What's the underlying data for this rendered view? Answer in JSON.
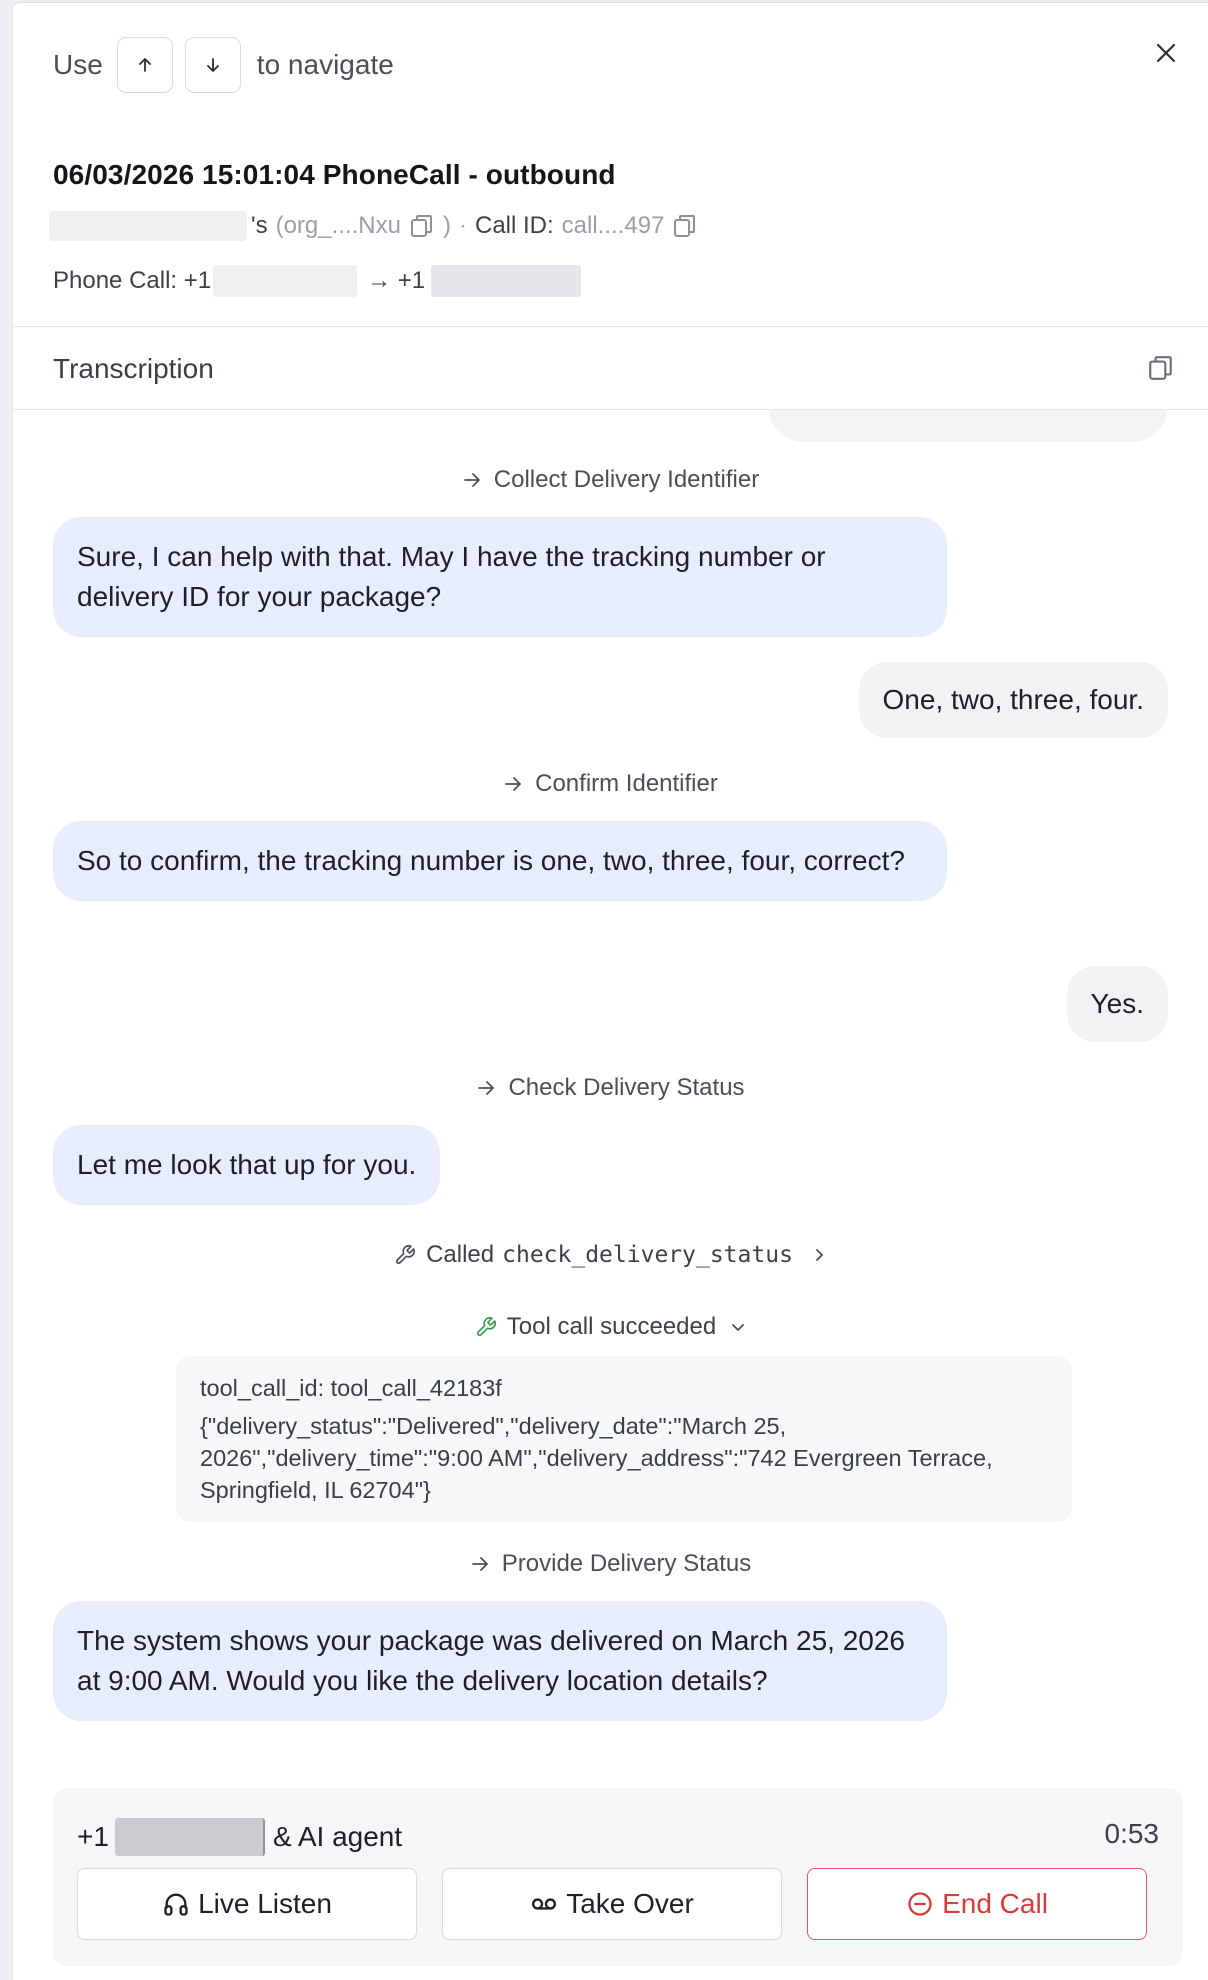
{
  "header": {
    "nav_prefix": "Use",
    "nav_suffix": "to navigate",
    "up_key_icon": "arrow-up-icon",
    "down_key_icon": "arrow-down-icon",
    "close_icon": "close-icon"
  },
  "call": {
    "title": "06/03/2026 15:01:04 PhoneCall - outbound",
    "org_possessive": "'s",
    "org_id": "(org_....Nxu",
    "org_close": ")",
    "separator": "·",
    "call_id_label": "Call ID:",
    "call_id": "call....497",
    "phone_label": "Phone Call: +1",
    "arrow_to": "→ +1"
  },
  "transcription": {
    "title": "Transcription",
    "copy_icon": "copy-icon"
  },
  "messages": [
    {
      "kind": "node",
      "text": "Collect Delivery Identifier"
    },
    {
      "kind": "agent",
      "text": "Sure, I can help with that. May I have the tracking number or delivery ID for your package?"
    },
    {
      "kind": "user",
      "text": "One, two, three, four."
    },
    {
      "kind": "node",
      "text": "Confirm Identifier"
    },
    {
      "kind": "agent",
      "text": "So to confirm, the tracking number is one, two, three, four, correct?"
    },
    {
      "kind": "user",
      "text": "Yes."
    },
    {
      "kind": "node",
      "text": "Check Delivery Status"
    },
    {
      "kind": "agent",
      "text": "Let me look that up for you."
    },
    {
      "kind": "tool_called",
      "label": "Called",
      "tool": "check_delivery_status"
    },
    {
      "kind": "tool_result_toggle",
      "text": "Tool call succeeded"
    },
    {
      "kind": "tool_result",
      "id_line": "tool_call_id: tool_call_42183f",
      "body": "{\"delivery_status\":\"Delivered\",\"delivery_date\":\"March 25, 2026\",\"delivery_time\":\"9:00 AM\",\"delivery_address\":\"742 Evergreen Terrace, Springfield, IL 62704\"}"
    },
    {
      "kind": "node",
      "text": "Provide Delivery Status"
    },
    {
      "kind": "agent",
      "text": "The system shows your package was delivered on March 25, 2026 at 9:00 AM. Would you like the delivery location details?"
    }
  ],
  "footer": {
    "caller_prefix": "+1",
    "caller_suffix": "& AI agent",
    "timer": "0:53",
    "live_listen": "Live Listen",
    "take_over": "Take Over",
    "end_call": "End Call",
    "colors": {
      "end_call": "#d93a3a",
      "agent_bubble": "#e7edfc",
      "success_icon": "#3a9a4a"
    }
  }
}
